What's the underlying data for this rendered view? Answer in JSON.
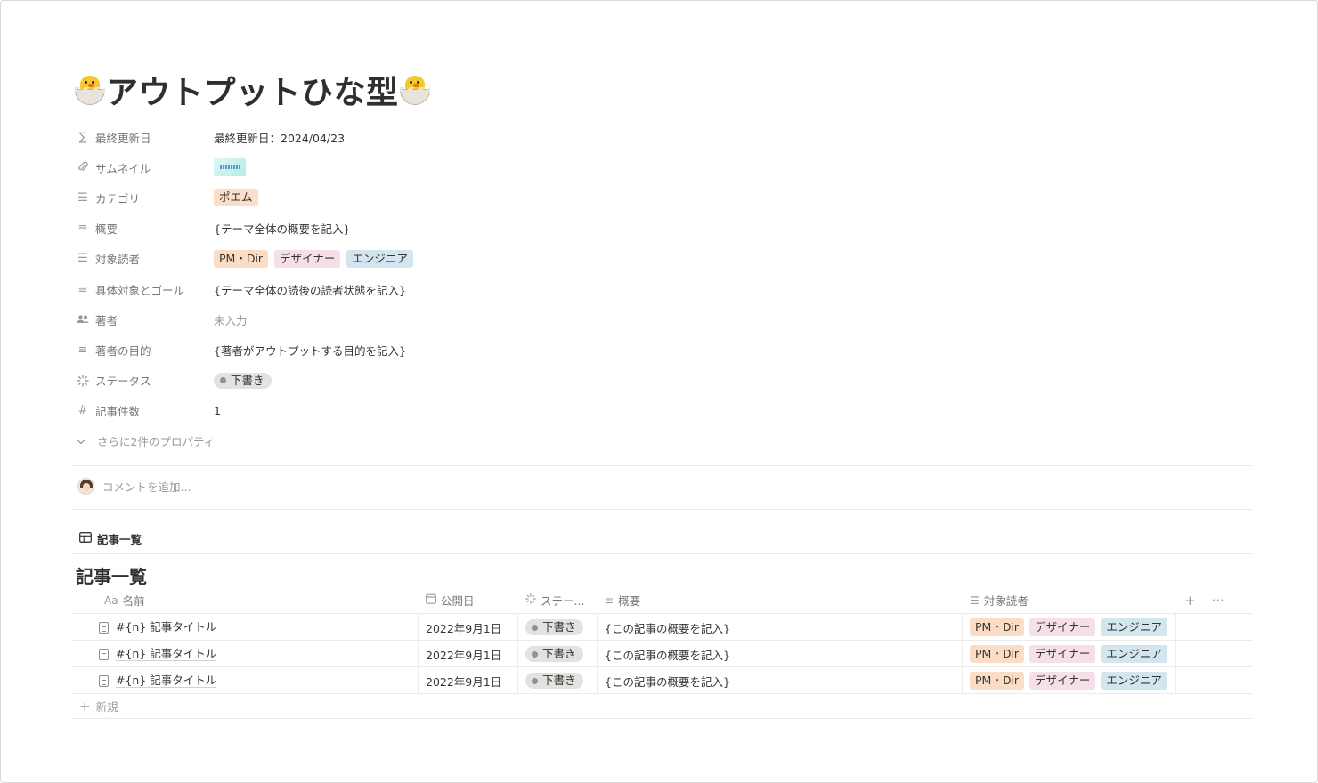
{
  "page": {
    "title": "アウトプットひな型",
    "title_icon": "hatching-chick-emoji"
  },
  "properties": [
    {
      "label": "最終更新日",
      "icon": "formula-sigma-icon",
      "value": "最終更新日：2024/04/23"
    },
    {
      "label": "サムネイル",
      "icon": "paperclip-icon",
      "value_type": "thumbnail"
    },
    {
      "label": "カテゴリ",
      "icon": "list-icon",
      "tags": [
        "ポエム"
      ]
    },
    {
      "label": "概要",
      "icon": "text-lines-icon",
      "value": "{テーマ全体の概要を記入}"
    },
    {
      "label": "対象読者",
      "icon": "list-icon",
      "tags": [
        "PM・Dir",
        "デザイナー",
        "エンジニア"
      ]
    },
    {
      "label": "具体対象とゴール",
      "icon": "text-lines-icon",
      "value": "{テーマ全体の読後の読者状態を記入}"
    },
    {
      "label": "著者",
      "icon": "people-icon",
      "value": "未入力"
    },
    {
      "label": "著者の目的",
      "icon": "text-lines-icon",
      "value": "{著者がアウトプットする目的を記入}"
    },
    {
      "label": "ステータス",
      "icon": "status-spinner-icon",
      "status": "下書き"
    },
    {
      "label": "記事件数",
      "icon": "hash-icon",
      "value": "1"
    }
  ],
  "more_properties": "さらに2件のプロパティ",
  "comment": {
    "placeholder": "コメントを追加..."
  },
  "database": {
    "view_tab": "記事一覧",
    "title": "記事一覧",
    "columns": [
      "名前",
      "公開日",
      "ステー...",
      "概要",
      "対象読者"
    ],
    "name_col_prefix": "Aa",
    "rows": [
      {
        "name": "#{n} 記事タイトル",
        "date": "2022年9月1日",
        "status": "下書き",
        "summary": "{この記事の概要を記入}",
        "readers": [
          "PM・Dir",
          "デザイナー",
          "エンジニア"
        ]
      },
      {
        "name": "#{n} 記事タイトル",
        "date": "2022年9月1日",
        "status": "下書き",
        "summary": "{この記事の概要を記入}",
        "readers": [
          "PM・Dir",
          "デザイナー",
          "エンジニア"
        ]
      },
      {
        "name": "#{n} 記事タイトル",
        "date": "2022年9月1日",
        "status": "下書き",
        "summary": "{この記事の概要を記入}",
        "readers": [
          "PM・Dir",
          "デザイナー",
          "エンジニア"
        ]
      }
    ],
    "new_row_label": "新規",
    "add_column_symbol": "+",
    "more_symbol": "···"
  },
  "colors": {
    "tag_category": "#fadec9",
    "tag_pm": "#fbdcc5",
    "tag_designer": "#f5e0e9",
    "tag_engineer": "#d3e5ef",
    "status_bg": "#e3e2e0"
  }
}
